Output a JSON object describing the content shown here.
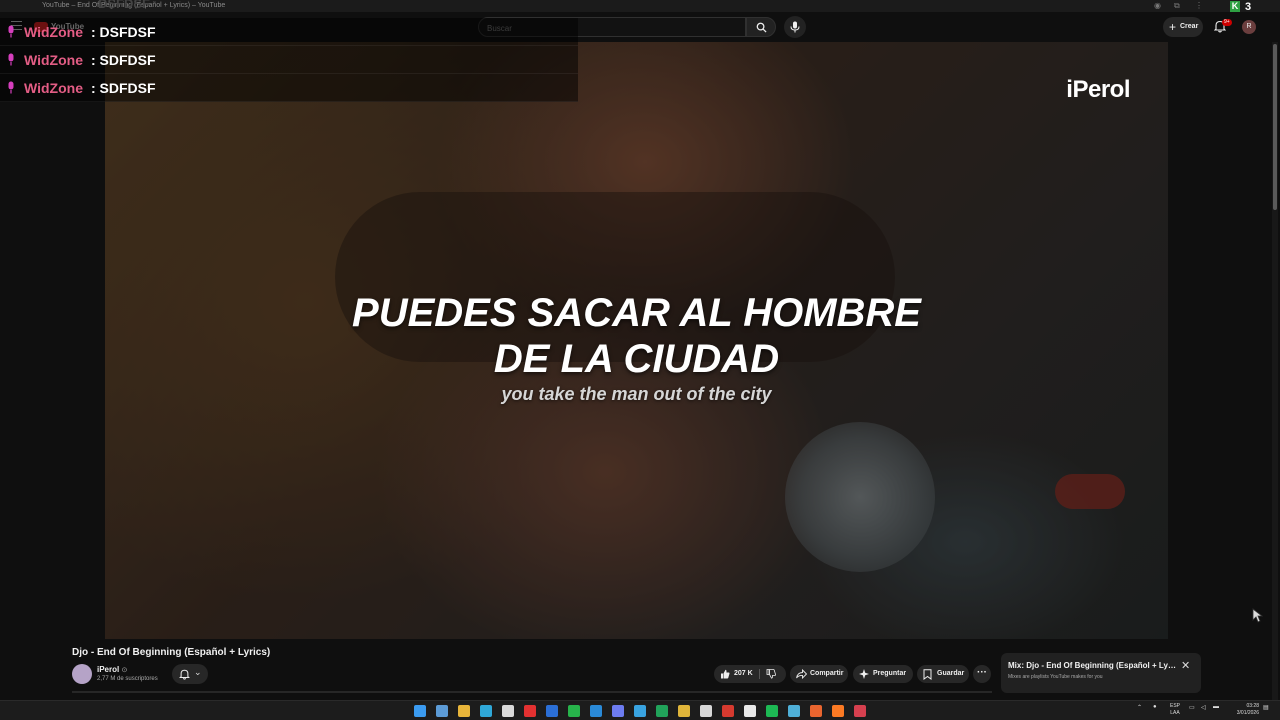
{
  "browser": {
    "tab_title": "YouTube – End Of Beginning (Español + Lyrics) – YouTube",
    "ghost_text": "DSFDSF",
    "ext_counter": "3"
  },
  "header": {
    "logo_text": "YouTube",
    "search_placeholder": "Buscar",
    "create_label": "Crear",
    "notif_badge": "9+",
    "avatar_letter": "R"
  },
  "chat": [
    {
      "user": "WidZone",
      "message": ": DSFDSF"
    },
    {
      "user": "WidZone",
      "message": ": SDFDSF"
    },
    {
      "user": "WidZone",
      "message": ": SDFDSF"
    }
  ],
  "video": {
    "watermark": "iPerol",
    "subtitle_line1": "PUEDES SACAR AL HOMBRE",
    "subtitle_line2": "DE LA CIUDAD",
    "subtitle_translation": "you take the man out of the city"
  },
  "meta": {
    "title": "Djo - End Of Beginning (Español + Lyrics)",
    "channel": "iPerol",
    "verified": "⊙",
    "subscribers": "2,77 M de suscriptores",
    "likes": "207 K",
    "share_label": "Compartir",
    "ask_label": "Preguntar",
    "save_label": "Guardar",
    "more_label": "···"
  },
  "mix": {
    "title": "Mix: Djo - End Of Beginning (Español + Lyrics)",
    "subtitle": "Mixes are playlists YouTube makes for you"
  },
  "taskbar": {
    "lang_line1": "ESP",
    "lang_line2": "LAA",
    "time": "03:28",
    "date": "3/01/2026",
    "icons": [
      {
        "name": "windows-start-icon",
        "color": "#3b9bf0"
      },
      {
        "name": "copilot-icon",
        "color": "#5c9bd6"
      },
      {
        "name": "file-explorer-icon",
        "color": "#e8b53a"
      },
      {
        "name": "edge-icon",
        "color": "#2fa8d8"
      },
      {
        "name": "store-icon",
        "color": "#d9d9d9"
      },
      {
        "name": "youtube-icon",
        "color": "#e33131"
      },
      {
        "name": "word-icon",
        "color": "#2b6fd6"
      },
      {
        "name": "whatsapp-icon",
        "color": "#27b34b"
      },
      {
        "name": "vscode-icon",
        "color": "#2a8ad8"
      },
      {
        "name": "app-a-icon",
        "color": "#6d7cf0"
      },
      {
        "name": "app-cloud-icon",
        "color": "#39a3e0"
      },
      {
        "name": "excel-icon",
        "color": "#21a35a"
      },
      {
        "name": "chrome-icon",
        "color": "#e0b53a"
      },
      {
        "name": "app-grid-icon",
        "color": "#d8d8d8"
      },
      {
        "name": "app-l-icon",
        "color": "#d63a2f"
      },
      {
        "name": "app-n-icon",
        "color": "#e8e8e8"
      },
      {
        "name": "spotify-icon",
        "color": "#1db954"
      },
      {
        "name": "notes-icon",
        "color": "#4fb0d8"
      },
      {
        "name": "app-orange-icon",
        "color": "#e9652f"
      },
      {
        "name": "xampp-icon",
        "color": "#fb7a24"
      },
      {
        "name": "app-bug-icon",
        "color": "#d6404f"
      }
    ]
  }
}
